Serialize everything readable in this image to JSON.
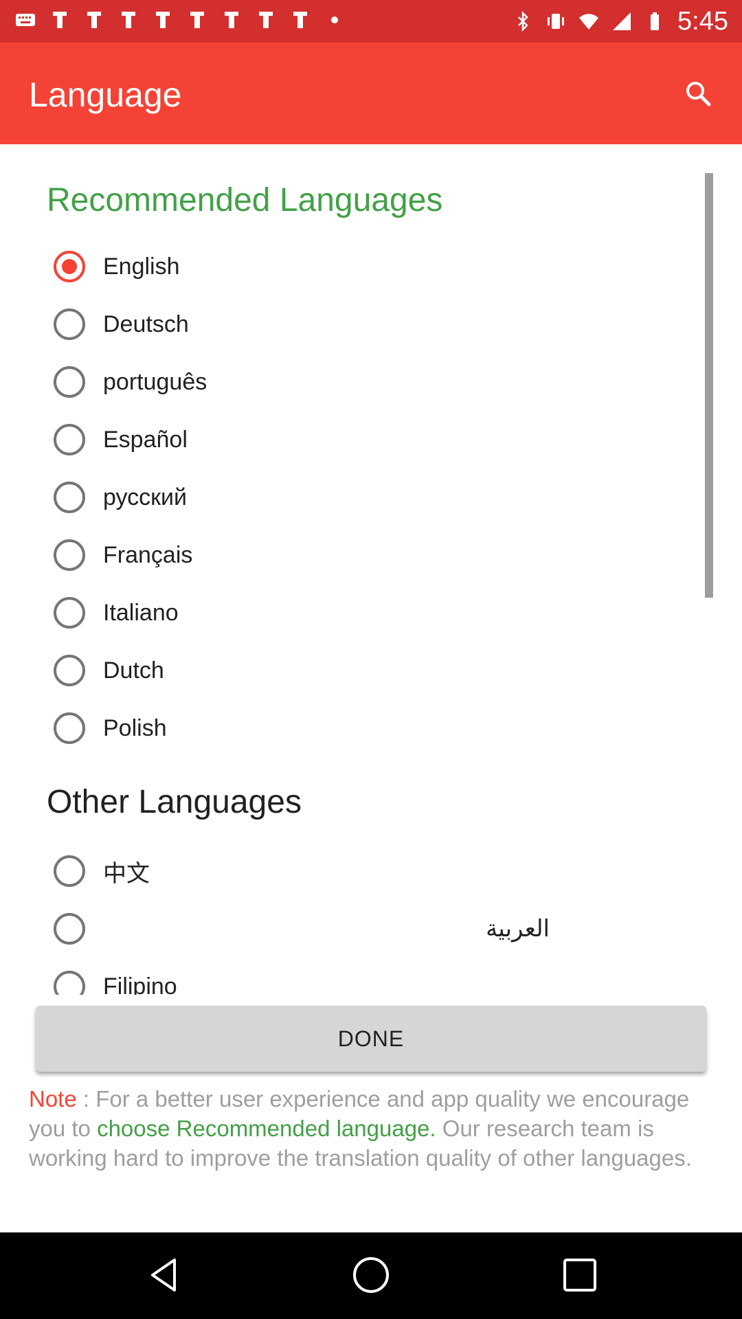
{
  "status_bar": {
    "time": "5:45",
    "left_icons": [
      "keyboard-icon",
      "notification-icon",
      "notification-icon",
      "notification-icon",
      "notification-icon",
      "notification-icon",
      "notification-icon",
      "notification-icon",
      "notification-icon",
      "more-dots-icon"
    ],
    "right_icons": [
      "bluetooth-icon",
      "vibrate-icon",
      "wifi-icon",
      "signal-icon",
      "battery-icon"
    ]
  },
  "app_bar": {
    "title": "Language",
    "search_icon": "search-icon",
    "color": "#f44336"
  },
  "recommended": {
    "title": "Recommended Languages",
    "items": [
      {
        "label": "English",
        "selected": true
      },
      {
        "label": "Deutsch",
        "selected": false
      },
      {
        "label": "português",
        "selected": false
      },
      {
        "label": "Español",
        "selected": false
      },
      {
        "label": "русский",
        "selected": false
      },
      {
        "label": "Français",
        "selected": false
      },
      {
        "label": "Italiano",
        "selected": false
      },
      {
        "label": "Dutch",
        "selected": false
      },
      {
        "label": "Polish",
        "selected": false
      }
    ]
  },
  "other": {
    "title": "Other Languages",
    "items": [
      {
        "label": "中文",
        "selected": false
      },
      {
        "label": "العربية",
        "selected": false
      },
      {
        "label": "Filipino",
        "selected": false
      }
    ]
  },
  "done_button": {
    "label": "DONE"
  },
  "note": {
    "prefix": "Note",
    "part1": " : For a better user experience and app quality we encourage you to ",
    "highlight": "choose Recommended language.",
    "part2": " Our research team is working hard to improve the translation quality of other languages."
  },
  "nav_bar": {
    "back": "back-icon",
    "home": "home-icon",
    "recents": "recents-icon"
  },
  "colors": {
    "accent": "#f44336",
    "green": "#43a047",
    "status_bar": "#d32f2f"
  }
}
